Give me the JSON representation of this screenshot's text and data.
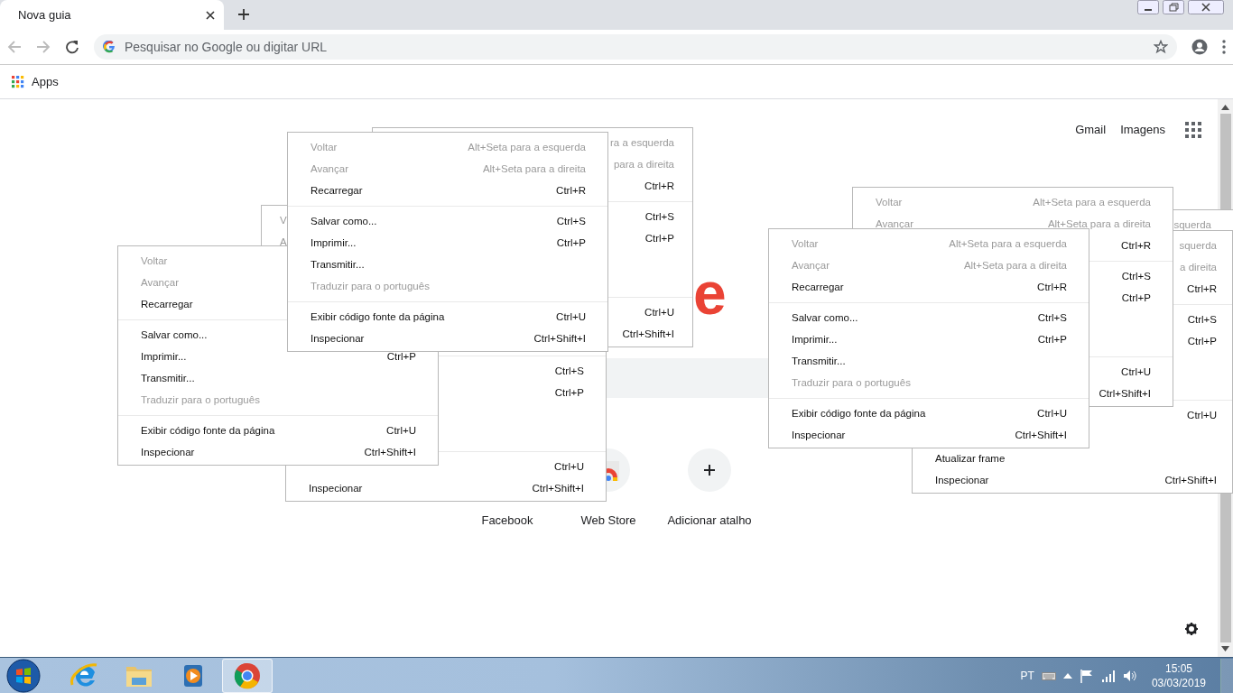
{
  "tabs": [
    {
      "label": "Nova guia",
      "selected": true
    }
  ],
  "navigation": {
    "back": {
      "disabled": true
    },
    "forward": {
      "disabled": true
    }
  },
  "omnibox": {
    "placeholder": "Pesquisar no Google ou digitar URL"
  },
  "bookmarks": [
    {
      "label": "Apps"
    }
  ],
  "header_links": [
    "Gmail",
    "Imagens"
  ],
  "logo_fragment": "e",
  "shortcuts": [
    {
      "kind": "covered",
      "label": "Facebook"
    },
    {
      "kind": "webstore",
      "label": "Web Store"
    },
    {
      "kind": "add",
      "label": "Adicionar atalho"
    }
  ],
  "menus": [
    {
      "items": [
        {
          "kind": "item",
          "shortcut": "ra a esquerda",
          "disabled": true
        },
        {
          "kind": "item",
          "shortcut": "para a direita",
          "disabled": true
        },
        {
          "kind": "item",
          "shortcut": "Ctrl+R",
          "disabled": false
        },
        {
          "kind": "separator"
        },
        {
          "kind": "item",
          "shortcut": "Ctrl+S",
          "disabled": false
        },
        {
          "kind": "item",
          "shortcut": "Ctrl+P",
          "disabled": false
        },
        {
          "kind": "blank"
        },
        {
          "kind": "blank"
        },
        {
          "kind": "separator"
        },
        {
          "kind": "item",
          "shortcut": "Ctrl+U",
          "disabled": false
        },
        {
          "kind": "item",
          "shortcut": "Ctrl+Shift+I",
          "disabled": false
        }
      ]
    },
    {
      "items": [
        {
          "kind": "item",
          "label": "V",
          "disabled": true
        },
        {
          "kind": "item",
          "label": "A",
          "disabled": true
        },
        {
          "kind": "blank"
        },
        {
          "kind": "separator"
        },
        {
          "kind": "blank"
        },
        {
          "kind": "blank"
        },
        {
          "kind": "blank"
        },
        {
          "kind": "blank"
        },
        {
          "kind": "separator"
        },
        {
          "kind": "blank"
        },
        {
          "kind": "blank"
        }
      ]
    },
    {
      "items": [
        {
          "kind": "blank"
        },
        {
          "kind": "blank"
        },
        {
          "kind": "blank"
        },
        {
          "kind": "separator"
        },
        {
          "kind": "item",
          "shortcut": "Ctrl+S",
          "disabled": false
        },
        {
          "kind": "item",
          "shortcut": "Ctrl+P",
          "disabled": false
        },
        {
          "kind": "blank"
        },
        {
          "kind": "blank"
        },
        {
          "kind": "separator"
        },
        {
          "kind": "item",
          "shortcut": "Ctrl+U",
          "disabled": false
        },
        {
          "kind": "item",
          "label": "Inspecionar",
          "shortcut": "Ctrl+Shift+I",
          "disabled": false
        }
      ]
    },
    {
      "items": [
        {
          "kind": "item",
          "label": "Voltar",
          "disabled": true
        },
        {
          "kind": "item",
          "label": "Avançar",
          "disabled": true
        },
        {
          "kind": "item",
          "label": "Recarregar",
          "disabled": false
        },
        {
          "kind": "separator"
        },
        {
          "kind": "item",
          "label": "Salvar como...",
          "disabled": false
        },
        {
          "kind": "item",
          "label": "Imprimir...",
          "shortcut": "Ctrl+P",
          "disabled": false
        },
        {
          "kind": "item",
          "label": "Transmitir...",
          "disabled": false
        },
        {
          "kind": "item",
          "label": "Traduzir para o português",
          "disabled": true
        },
        {
          "kind": "separator"
        },
        {
          "kind": "item",
          "label": "Exibir código fonte da página",
          "shortcut": "Ctrl+U",
          "disabled": false
        },
        {
          "kind": "item",
          "label": "Inspecionar",
          "shortcut": "Ctrl+Shift+I",
          "disabled": false
        }
      ]
    },
    {
      "items": [
        {
          "kind": "item",
          "label": "Voltar",
          "shortcut": "Alt+Seta para a esquerda",
          "disabled": true
        },
        {
          "kind": "item",
          "label": "Avançar",
          "shortcut": "Alt+Seta para a direita",
          "disabled": true
        },
        {
          "kind": "item",
          "label": "Recarregar",
          "shortcut": "Ctrl+R",
          "disabled": false
        },
        {
          "kind": "separator"
        },
        {
          "kind": "item",
          "label": "Salvar como...",
          "shortcut": "Ctrl+S",
          "disabled": false
        },
        {
          "kind": "item",
          "label": "Imprimir...",
          "shortcut": "Ctrl+P",
          "disabled": false
        },
        {
          "kind": "item",
          "label": "Transmitir...",
          "disabled": false
        },
        {
          "kind": "item",
          "label": "Traduzir para o português",
          "disabled": true
        },
        {
          "kind": "separator"
        },
        {
          "kind": "item",
          "label": "Exibir código fonte da página",
          "shortcut": "Ctrl+U",
          "disabled": false
        },
        {
          "kind": "item",
          "label": "Inspecionar",
          "shortcut": "Ctrl+Shift+I",
          "disabled": false
        }
      ]
    },
    {
      "items": [
        {
          "kind": "item",
          "shortcut": "squerda",
          "disabled": true
        },
        {
          "kind": "blank"
        },
        {
          "kind": "blank"
        },
        {
          "kind": "separator"
        },
        {
          "kind": "blank"
        },
        {
          "kind": "blank"
        },
        {
          "kind": "blank"
        },
        {
          "kind": "blank"
        },
        {
          "kind": "separator"
        },
        {
          "kind": "blank"
        },
        {
          "kind": "blank"
        }
      ]
    },
    {
      "items": [
        {
          "kind": "item",
          "shortcut": "squerda",
          "disabled": true
        },
        {
          "kind": "item",
          "shortcut": "a direita",
          "disabled": true
        },
        {
          "kind": "item",
          "shortcut": "Ctrl+R",
          "disabled": false
        },
        {
          "kind": "separator"
        },
        {
          "kind": "item",
          "shortcut": "Ctrl+S",
          "disabled": false
        },
        {
          "kind": "item",
          "shortcut": "Ctrl+P",
          "disabled": false
        },
        {
          "kind": "blank"
        },
        {
          "kind": "blank"
        },
        {
          "kind": "separator"
        },
        {
          "kind": "item",
          "shortcut": "Ctrl+U",
          "disabled": false
        },
        {
          "kind": "blank"
        },
        {
          "kind": "item",
          "label": "Atualizar frame",
          "disabled": false
        },
        {
          "kind": "item",
          "label": "Inspecionar",
          "shortcut": "Ctrl+Shift+I",
          "disabled": false
        }
      ]
    },
    {
      "items": [
        {
          "kind": "item",
          "label": "Voltar",
          "shortcut": "Alt+Seta para a esquerda",
          "disabled": true
        },
        {
          "kind": "item",
          "label": "Avançar",
          "shortcut": "Alt+Seta para a direita",
          "disabled": true
        },
        {
          "kind": "item",
          "shortcut": "Ctrl+R",
          "disabled": false
        },
        {
          "kind": "separator"
        },
        {
          "kind": "item",
          "shortcut": "Ctrl+S",
          "disabled": false
        },
        {
          "kind": "item",
          "shortcut": "Ctrl+P",
          "disabled": false
        },
        {
          "kind": "blank"
        },
        {
          "kind": "blank"
        },
        {
          "kind": "separator"
        },
        {
          "kind": "item",
          "shortcut": "Ctrl+U",
          "disabled": false
        },
        {
          "kind": "item",
          "shortcut": "Ctrl+Shift+I",
          "disabled": false
        }
      ]
    },
    {
      "items": [
        {
          "kind": "item",
          "label": "Voltar",
          "shortcut": "Alt+Seta para a esquerda",
          "disabled": true
        },
        {
          "kind": "item",
          "label": "Avançar",
          "shortcut": "Alt+Seta para a direita",
          "disabled": true
        },
        {
          "kind": "item",
          "label": "Recarregar",
          "shortcut": "Ctrl+R",
          "disabled": false
        },
        {
          "kind": "separator"
        },
        {
          "kind": "item",
          "label": "Salvar como...",
          "shortcut": "Ctrl+S",
          "disabled": false
        },
        {
          "kind": "item",
          "label": "Imprimir...",
          "shortcut": "Ctrl+P",
          "disabled": false
        },
        {
          "kind": "item",
          "label": "Transmitir...",
          "disabled": false
        },
        {
          "kind": "item",
          "label": "Traduzir para o português",
          "disabled": true
        },
        {
          "kind": "separator"
        },
        {
          "kind": "item",
          "label": "Exibir código fonte da página",
          "shortcut": "Ctrl+U",
          "disabled": false
        },
        {
          "kind": "item",
          "label": "Inspecionar",
          "shortcut": "Ctrl+Shift+I",
          "disabled": false
        }
      ]
    }
  ],
  "taskbar": {
    "apps": [
      {
        "kind": "ie",
        "selected": false
      },
      {
        "kind": "explorer",
        "selected": false
      },
      {
        "kind": "media",
        "selected": false
      },
      {
        "kind": "chrome",
        "selected": true
      }
    ]
  },
  "tray": {
    "language": "PT",
    "time": "15:05",
    "date": "03/03/2019"
  }
}
